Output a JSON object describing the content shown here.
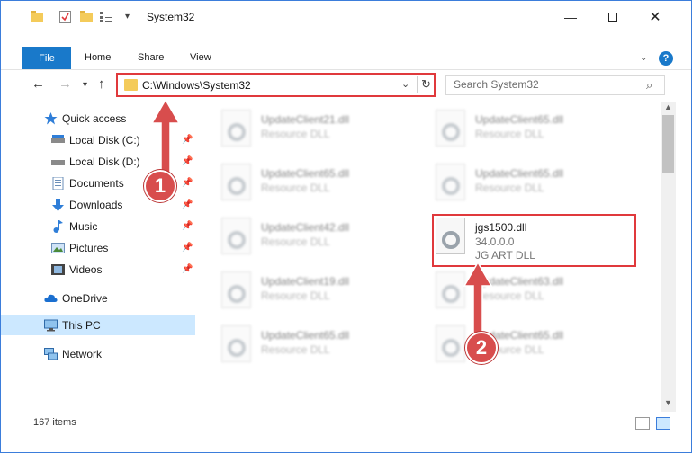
{
  "window": {
    "title": "System32"
  },
  "ribbon": {
    "tabs": [
      "File",
      "Home",
      "Share",
      "View"
    ]
  },
  "address": {
    "path": "C:\\Windows\\System32"
  },
  "search": {
    "placeholder": "Search System32"
  },
  "sidebar": {
    "items": [
      {
        "label": "Quick access",
        "icon": "star-icon",
        "pinned": false
      },
      {
        "label": "Local Disk (C:)",
        "icon": "drive-icon",
        "pinned": true
      },
      {
        "label": "Local Disk (D:)",
        "icon": "drive-icon",
        "pinned": true
      },
      {
        "label": "Documents",
        "icon": "documents-icon",
        "pinned": true
      },
      {
        "label": "Downloads",
        "icon": "download-icon",
        "pinned": true
      },
      {
        "label": "Music",
        "icon": "music-icon",
        "pinned": true
      },
      {
        "label": "Pictures",
        "icon": "pictures-icon",
        "pinned": true
      },
      {
        "label": "Videos",
        "icon": "videos-icon",
        "pinned": true
      },
      {
        "label": "OneDrive",
        "icon": "cloud-icon",
        "pinned": false
      },
      {
        "label": "This PC",
        "icon": "computer-icon",
        "pinned": false,
        "selected": true
      },
      {
        "label": "Network",
        "icon": "network-icon",
        "pinned": false
      }
    ]
  },
  "files": [
    {
      "name": "UpdateClient21.dll",
      "type": "Resource DLL",
      "blurred": true
    },
    {
      "name": "UpdateClient65.dll",
      "type": "Resource DLL",
      "blurred": true
    },
    {
      "name": "UpdateClient65.dll",
      "type": "Resource DLL",
      "blurred": true
    },
    {
      "name": "UpdateClient65.dll",
      "type": "Resource DLL",
      "blurred": true
    },
    {
      "name": "UpdateClient42.dll",
      "type": "Resource DLL",
      "blurred": true
    },
    {
      "name": "jgs1500.dll",
      "version": "34.0.0.0",
      "type": "JG ART DLL",
      "blurred": false
    },
    {
      "name": "UpdateClient19.dll",
      "type": "Resource DLL",
      "blurred": true
    },
    {
      "name": "UpdateClient63.dll",
      "type": "Resource DLL",
      "blurred": true
    },
    {
      "name": "UpdateClient65.dll",
      "type": "Resource DLL",
      "blurred": true
    },
    {
      "name": "UpdateClient65.dll",
      "type": "Resource DLL",
      "blurred": true
    }
  ],
  "status": {
    "count": "167 items"
  },
  "callouts": [
    {
      "number": "1"
    },
    {
      "number": "2"
    }
  ],
  "colors": {
    "accent": "#1979ca",
    "highlight": "#e0393c",
    "selection": "#cce8ff"
  }
}
